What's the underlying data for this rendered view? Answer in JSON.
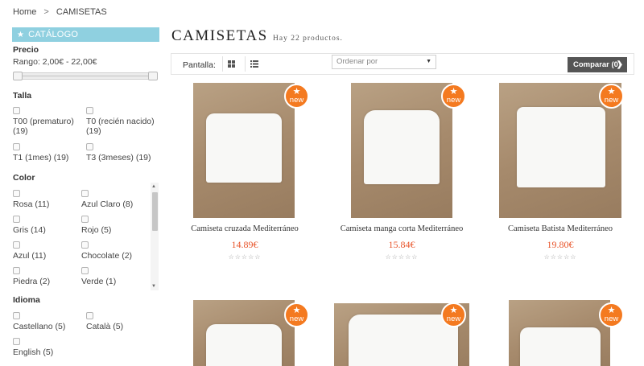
{
  "breadcrumb": {
    "home": "Home",
    "separator": ">",
    "current": "CAMISETAS"
  },
  "sidebar": {
    "catalog_label": "CATÁLOGO",
    "price": {
      "title": "Precio",
      "range": "Rango: 2,00€ - 22,00€"
    },
    "size": {
      "title": "Talla",
      "options": [
        {
          "label": "T00 (prematuro)",
          "count": "(19)"
        },
        {
          "label": "T0 (recién nacido)",
          "count": "(19)"
        },
        {
          "label": "T1 (1mes) (19)"
        },
        {
          "label": "T3 (3meses) (19)"
        }
      ]
    },
    "color": {
      "title": "Color",
      "options": [
        {
          "label": "Rosa (11)"
        },
        {
          "label": "Azul Claro (8)"
        },
        {
          "label": "Gris (14)"
        },
        {
          "label": "Rojo (5)"
        },
        {
          "label": "Azul (11)"
        },
        {
          "label": "Chocolate (2)"
        },
        {
          "label": "Piedra (2)"
        },
        {
          "label": "Verde (1)"
        }
      ]
    },
    "language": {
      "title": "Idioma",
      "options": [
        {
          "label": "Castellano (5)"
        },
        {
          "label": "Català (5)"
        },
        {
          "label": "English (5)"
        }
      ]
    }
  },
  "main": {
    "title": "CAMISETAS",
    "subtitle": "Hay 22 productos.",
    "toolbar": {
      "display_label": "Pantalla:",
      "sort_placeholder": "Ordenar por",
      "compare_label": "Comparar (0)"
    },
    "badge_text": "new",
    "products": [
      {
        "name": "Camiseta cruzada Mediterráneo",
        "price": "14.89€",
        "rating": "☆☆☆☆☆"
      },
      {
        "name": "Camiseta manga corta Mediterráneo",
        "price": "15.84€",
        "rating": "☆☆☆☆☆"
      },
      {
        "name": "Camiseta Batista Mediterráneo",
        "price": "19.80€",
        "rating": "☆☆☆☆☆"
      },
      {
        "name": "",
        "price": "",
        "rating": ""
      },
      {
        "name": "",
        "price": "",
        "rating": ""
      },
      {
        "name": "",
        "price": "",
        "rating": ""
      }
    ]
  },
  "colors": {
    "accent": "#8fd0e0",
    "badge": "#f47a20",
    "price": "#e8552b",
    "compare_bg": "#555555"
  }
}
